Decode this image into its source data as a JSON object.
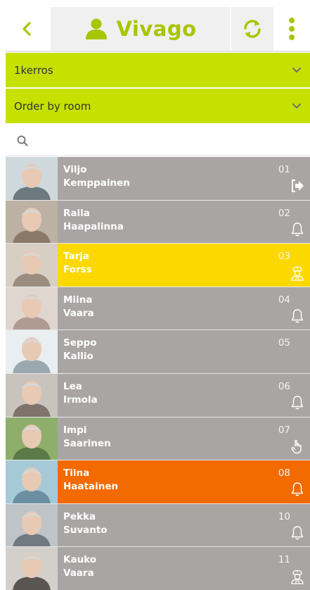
{
  "header": {
    "back_icon": "chevron-left-icon",
    "app_icon": "person-icon",
    "app_name": "Vivago",
    "refresh_icon": "refresh-icon",
    "menu_icon": "more-vertical-icon",
    "accent": "#a8c500"
  },
  "filters": {
    "floor": "1kerros",
    "order": "Order by room"
  },
  "search": {
    "icon": "search-icon"
  },
  "residents": [
    {
      "first": "Viljo",
      "last": "Kemppainen",
      "room": "01",
      "status": "exit-icon",
      "highlight": "none"
    },
    {
      "first": "Raila",
      "last": "Haapalinna",
      "room": "02",
      "status": "bell-icon",
      "highlight": "none"
    },
    {
      "first": "Tarja",
      "last": "Forss",
      "room": "03",
      "status": "nurse-icon",
      "highlight": "yellow"
    },
    {
      "first": "Miina",
      "last": "Vaara",
      "room": "04",
      "status": "bell-icon",
      "highlight": "none"
    },
    {
      "first": "Seppo",
      "last": "Kallio",
      "room": "05",
      "status": "none",
      "highlight": "none"
    },
    {
      "first": "Lea",
      "last": "Irmola",
      "room": "06",
      "status": "bell-icon",
      "highlight": "none"
    },
    {
      "first": "Impi",
      "last": "Saarinen",
      "room": "07",
      "status": "hand-pointer-icon",
      "highlight": "none"
    },
    {
      "first": "Tiina",
      "last": "Haatainen",
      "room": "08",
      "status": "bell-icon",
      "highlight": "orange"
    },
    {
      "first": "Pekka",
      "last": "Suvanto",
      "room": "10",
      "status": "bell-icon",
      "highlight": "none"
    },
    {
      "first": "Kauko",
      "last": "Vaara",
      "room": "11",
      "status": "nurse-icon",
      "highlight": "none"
    }
  ]
}
